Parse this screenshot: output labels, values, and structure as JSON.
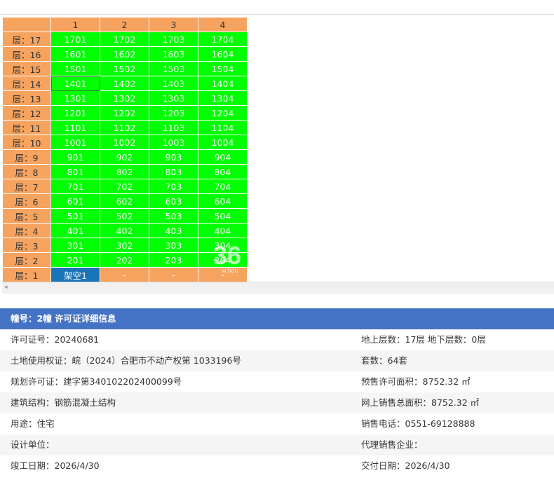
{
  "grid": {
    "columns": [
      "1",
      "2",
      "3",
      "4"
    ],
    "rows": [
      {
        "floor": "层：17",
        "units": [
          "1701",
          "1702",
          "1703",
          "1704"
        ]
      },
      {
        "floor": "层：16",
        "units": [
          "1601",
          "1602",
          "1603",
          "1604"
        ]
      },
      {
        "floor": "层：15",
        "units": [
          "1501",
          "1502",
          "1503",
          "1504"
        ]
      },
      {
        "floor": "层：14",
        "units": [
          "1401",
          "1402",
          "1403",
          "1404"
        ]
      },
      {
        "floor": "层：13",
        "units": [
          "1301",
          "1302",
          "1303",
          "1304"
        ]
      },
      {
        "floor": "层：12",
        "units": [
          "1201",
          "1202",
          "1203",
          "1204"
        ]
      },
      {
        "floor": "层：11",
        "units": [
          "1101",
          "1102",
          "1103",
          "1104"
        ]
      },
      {
        "floor": "层：10",
        "units": [
          "1001",
          "1002",
          "1003",
          "1004"
        ]
      },
      {
        "floor": "层：9",
        "units": [
          "901",
          "902",
          "903",
          "904"
        ]
      },
      {
        "floor": "层：8",
        "units": [
          "801",
          "802",
          "803",
          "804"
        ]
      },
      {
        "floor": "层：7",
        "units": [
          "701",
          "702",
          "703",
          "704"
        ]
      },
      {
        "floor": "层：6",
        "units": [
          "601",
          "602",
          "603",
          "604"
        ]
      },
      {
        "floor": "层：5",
        "units": [
          "501",
          "502",
          "503",
          "504"
        ]
      },
      {
        "floor": "层：4",
        "units": [
          "401",
          "402",
          "403",
          "404"
        ]
      },
      {
        "floor": "层：3",
        "units": [
          "301",
          "302",
          "303",
          "304"
        ]
      },
      {
        "floor": "层：2",
        "units": [
          "201",
          "202",
          "203",
          "204"
        ]
      },
      {
        "floor": "层：1",
        "units": [
          "架空1",
          "-",
          "-",
          "-"
        ]
      }
    ]
  },
  "colors": {
    "header_orange": "#f5a35f",
    "available_green": "#00ff00",
    "vacant_blue": "#1a75b8",
    "info_header_blue": "#4472c4"
  },
  "watermark": {
    "text": "36",
    "sub": "w.hou"
  },
  "info": {
    "title": "幢号：2幢 许可证详细信息",
    "rows": [
      {
        "left": "许可证号：20240681",
        "right": "地上层数：17层  地下层数：0层"
      },
      {
        "left": "土地使用权证：皖（2024）合肥市不动产权第 1033196号",
        "right": "套数：64套"
      },
      {
        "left": "规划许可证：建字第340102202400099号",
        "right": "预售许可面积：8752.32 ㎡"
      },
      {
        "left": "建筑结构：钢筋混凝土结构",
        "right": "网上销售总面积：8752.32 ㎡"
      },
      {
        "left": "用途：住宅",
        "right": "销售电话：0551-69128888"
      },
      {
        "left": "设计单位：",
        "right": "代理销售企业："
      },
      {
        "left": "竣工日期：2026/4/30",
        "right": "交付日期：2026/4/30"
      }
    ]
  }
}
